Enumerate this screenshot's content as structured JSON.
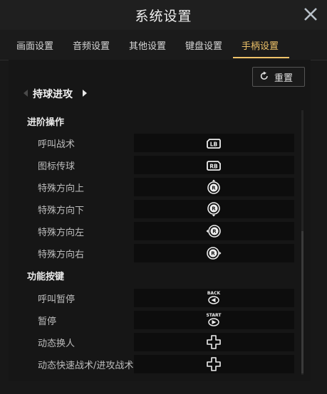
{
  "window": {
    "title": "系统设置"
  },
  "tabs": [
    {
      "label": "画面设置"
    },
    {
      "label": "音频设置"
    },
    {
      "label": "其他设置"
    },
    {
      "label": "键盘设置"
    },
    {
      "label": "手柄设置",
      "active": true
    }
  ],
  "reset_button": {
    "label": "重置"
  },
  "mode_selector": {
    "label": "持球进攻"
  },
  "sections": [
    {
      "title": "进阶操作",
      "rows": [
        {
          "label": "呼叫战术",
          "binding": "LB",
          "icon": "lb-button-icon"
        },
        {
          "label": "图标传球",
          "binding": "RB",
          "icon": "rb-button-icon"
        },
        {
          "label": "特殊方向上",
          "binding": "R",
          "icon": "right-stick-up-icon"
        },
        {
          "label": "特殊方向下",
          "binding": "R",
          "icon": "right-stick-down-icon"
        },
        {
          "label": "特殊方向左",
          "binding": "R",
          "icon": "right-stick-left-icon"
        },
        {
          "label": "特殊方向右",
          "binding": "R",
          "icon": "right-stick-right-icon"
        }
      ]
    },
    {
      "title": "功能按键",
      "rows": [
        {
          "label": "呼叫暂停",
          "binding": "BACK",
          "icon": "back-button-icon"
        },
        {
          "label": "暂停",
          "binding": "START",
          "icon": "start-button-icon"
        },
        {
          "label": "动态换人",
          "icon": "dpad-icon"
        },
        {
          "label": "动态快速战术/进攻战术",
          "icon": "dpad-icon"
        }
      ]
    }
  ],
  "colors": {
    "accent": "#f0c46a",
    "background": "#181818",
    "cell": "#0d0d0d"
  }
}
